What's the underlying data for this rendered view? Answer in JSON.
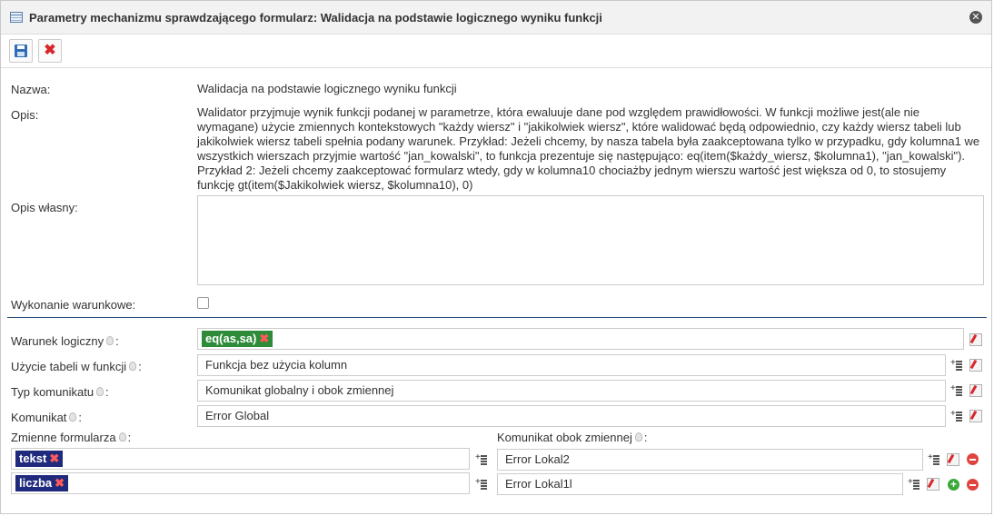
{
  "dialog": {
    "title": "Parametry mechanizmu sprawdzającego formularz: Walidacja na podstawie logicznego wyniku funkcji",
    "close_icon": "close-icon"
  },
  "toolbar": {
    "save_icon": "save-icon",
    "cancel_icon": "cancel-icon"
  },
  "form": {
    "nazwa_label": "Nazwa:",
    "nazwa_value": "Walidacja na podstawie logicznego wyniku funkcji",
    "opis_label": "Opis:",
    "opis_value": "Walidator przyjmuje wynik funkcji podanej w parametrze, która ewaluuje dane pod względem prawidłowości. W funkcji możliwe jest(ale nie wymagane) użycie zmiennych kontekstowych \"każdy wiersz\" i \"jakikolwiek wiersz\", które walidować będą odpowiednio, czy każdy wiersz tabeli lub jakikolwiek wiersz tabeli spełnia podany warunek. Przykład: Jeżeli chcemy, by nasza tabela była zaakceptowana tylko w przypadku, gdy kolumna1 we wszystkich wierszach przyjmie wartość \"jan_kowalski\", to funkcja prezentuje się następująco: eq(item($każdy_wiersz, $kolumna1), \"jan_kowalski\"). Przykład 2: Jeżeli chcemy zaakceptować formularz wtedy, gdy w kolumna10 chociażby jednym wierszu wartość jest większa od 0, to stosujemy funkcję gt(item($Jakikolwiek wiersz, $kolumna10), 0)",
    "opis_wlasny_label": "Opis własny:",
    "opis_wlasny_value": "",
    "wykonanie_label": "Wykonanie warunkowe:",
    "wykonanie_checked": false,
    "warunek_label": "Warunek logiczny",
    "warunek_tag": "eq(as,sa)",
    "uzycie_label": "Użycie tabeli w funkcji",
    "uzycie_value": "Funkcja bez użycia kolumn",
    "typ_label": "Typ komunikatu",
    "typ_value": "Komunikat globalny i obok zmiennej",
    "komunikat_label": "Komunikat",
    "komunikat_value": "Error Global",
    "zmienne_label": "Zmienne formularza",
    "komunikat_obok_label": "Komunikat obok zmiennej",
    "colon": ":",
    "rows": [
      {
        "tag": "tekst",
        "message": "Error Lokal2"
      },
      {
        "tag": "liczba",
        "message": "Error Lokal1l"
      }
    ]
  },
  "colors": {
    "tag_green": "#2e8b3a",
    "tag_navy": "#1f2a7d",
    "remove": "#d9262b",
    "separator": "#2a4d7a"
  }
}
